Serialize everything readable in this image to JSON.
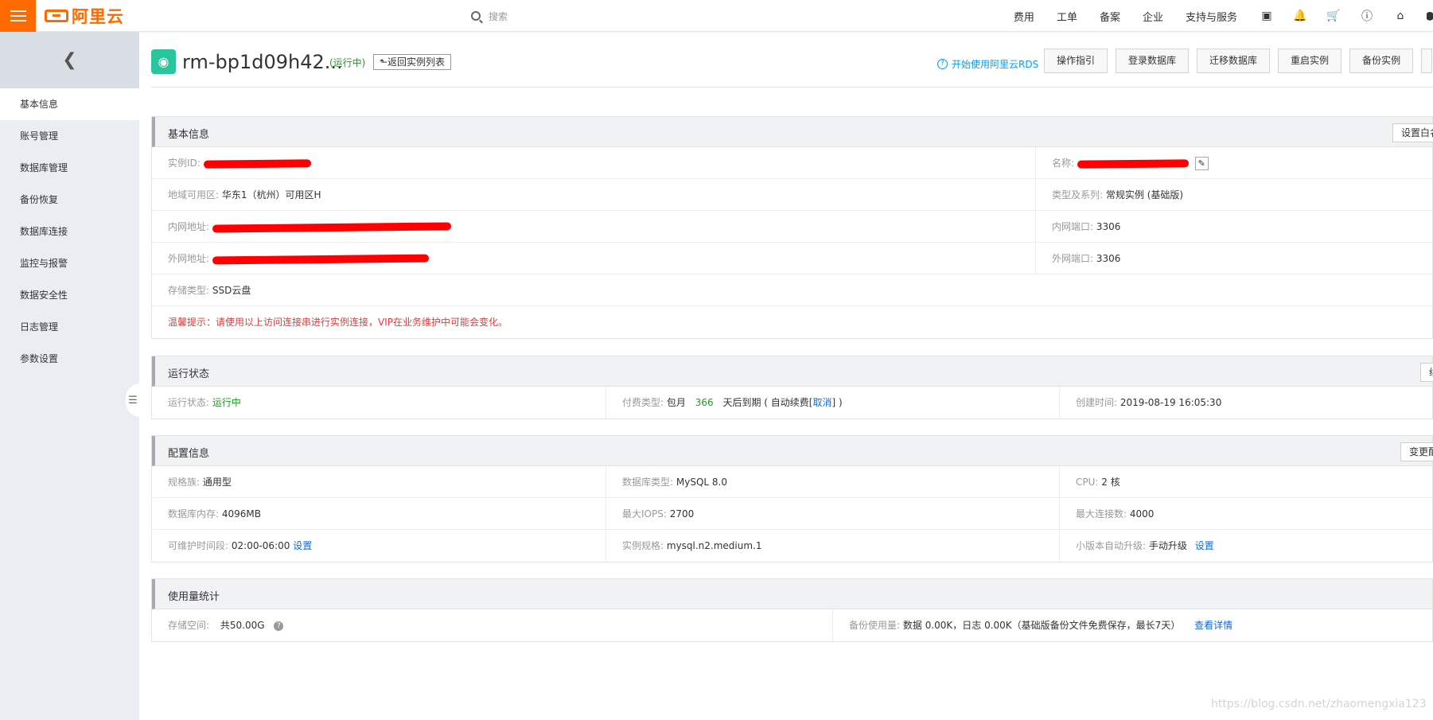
{
  "topbar": {
    "logo_text": "阿里云",
    "search_placeholder": "搜索",
    "nav": [
      "费用",
      "工单",
      "备案",
      "企业",
      "支持与服务"
    ]
  },
  "sidebar": {
    "items": [
      "基本信息",
      "账号管理",
      "数据库管理",
      "备份恢复",
      "数据库连接",
      "监控与报警",
      "数据安全性",
      "日志管理",
      "参数设置"
    ]
  },
  "header": {
    "instance_name": "rm-bp1d09h42...",
    "status": "(运行中)",
    "back_list": "返回实例列表",
    "start_link": "开始使用阿里云RDS",
    "buttons": [
      "操作指引",
      "登录数据库",
      "迁移数据库",
      "重启实例",
      "备份实例"
    ]
  },
  "basic": {
    "title": "基本信息",
    "right_btn": "设置白名",
    "instance_id_label": "实例ID:",
    "name_label": "名称:",
    "region_label": "地域可用区:",
    "region_value": "华东1（杭州）可用区H",
    "type_label": "类型及系列:",
    "type_value": "常规实例 (基础版)",
    "intranet_label": "内网地址:",
    "intranet_port_label": "内网端口:",
    "intranet_port": "3306",
    "internet_label": "外网地址:",
    "internet_port_label": "外网端口:",
    "internet_port": "3306",
    "storage_label": "存储类型:",
    "storage_value": "SSD云盘",
    "tip": "温馨提示：请使用以上访问连接串进行实例连接，VIP在业务维护中可能会变化。"
  },
  "running": {
    "title": "运行状态",
    "right_btn": "续",
    "status_label": "运行状态:",
    "status_value": "运行中",
    "pay_label": "付费类型:",
    "pay_value": "包月",
    "days": "366",
    "days_suffix": "天后到期 ( 自动续费[",
    "cancel": "取消",
    "close_bracket": "] )",
    "created_label": "创建时间:",
    "created_value": "2019-08-19 16:05:30"
  },
  "config": {
    "title": "配置信息",
    "right_btn": "变更配",
    "family_label": "规格族:",
    "family_value": "通用型",
    "dbtype_label": "数据库类型:",
    "dbtype_value": "MySQL 8.0",
    "cpu_label": "CPU:",
    "cpu_value": "2 核",
    "mem_label": "数据库内存:",
    "mem_value": "4096MB",
    "iops_label": "最大IOPS:",
    "iops_value": "2700",
    "conn_label": "最大连接数:",
    "conn_value": "4000",
    "maint_label": "可维护时间段:",
    "maint_value": "02:00-06:00",
    "set_link": "设置",
    "spec_label": "实例规格:",
    "spec_value": "mysql.n2.medium.1",
    "upgrade_label": "小版本自动升级:",
    "upgrade_value": "手动升级"
  },
  "usage": {
    "title": "使用量统计",
    "storage_label": "存储空间:",
    "storage_value": "共50.00G",
    "backup_label": "备份使用量:",
    "backup_value": "数据 0.00K，日志 0.00K（基础版备份文件免费保存，最长7天）",
    "detail_link": "查看详情"
  },
  "watermark": "https://blog.csdn.net/zhaomengxia123",
  "colors": {
    "brand": "#ff6a00",
    "running": "#1e9e25",
    "link": "#0c6cd8",
    "warning": "#e4393c",
    "redaction": "#ff0000"
  }
}
